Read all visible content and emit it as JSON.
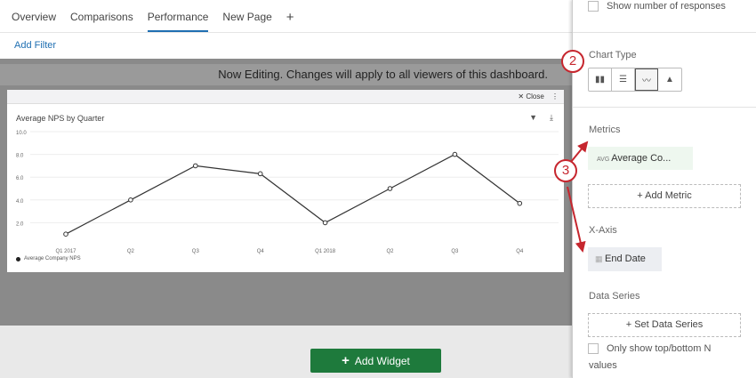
{
  "tabs": [
    "Overview",
    "Comparisons",
    "Performance",
    "New Page",
    "+"
  ],
  "active_tab": "Performance",
  "add_filter": "Add Filter",
  "banner": "Now Editing. Changes will apply to all viewers of this dashboard.",
  "add_widget": "Add Widget",
  "widget": {
    "close": "Close",
    "title": "Average NPS by Quarter"
  },
  "chart_data": {
    "type": "line",
    "title": "Average NPS by Quarter",
    "categories": [
      "Q1 2017",
      "Q2",
      "Q3",
      "Q4",
      "Q1 2018",
      "Q2",
      "Q3",
      "Q4"
    ],
    "series": [
      {
        "name": "Average Company NPS",
        "values": [
          1.0,
          4.0,
          7.0,
          6.3,
          2.0,
          5.0,
          8.0,
          3.7
        ]
      }
    ],
    "yticks": [
      "2.0",
      "4.0",
      "6.0",
      "8.0",
      "10.0"
    ],
    "ylim": [
      0,
      10
    ],
    "grid": true,
    "legend": "bottom-left"
  },
  "panel": {
    "show_responses": "Show number of responses",
    "chart_type": "Chart Type",
    "metrics": "Metrics",
    "metric_agg": "AVG",
    "metric_name": "Average Co...",
    "add_metric": "+ Add Metric",
    "x_axis": "X-Axis",
    "x_axis_value": "End Date",
    "data_series": "Data Series",
    "set_data_series": "+ Set Data Series",
    "top_bottom": "Only show top/bottom N",
    "values": "values"
  },
  "badges": [
    "2",
    "3"
  ]
}
